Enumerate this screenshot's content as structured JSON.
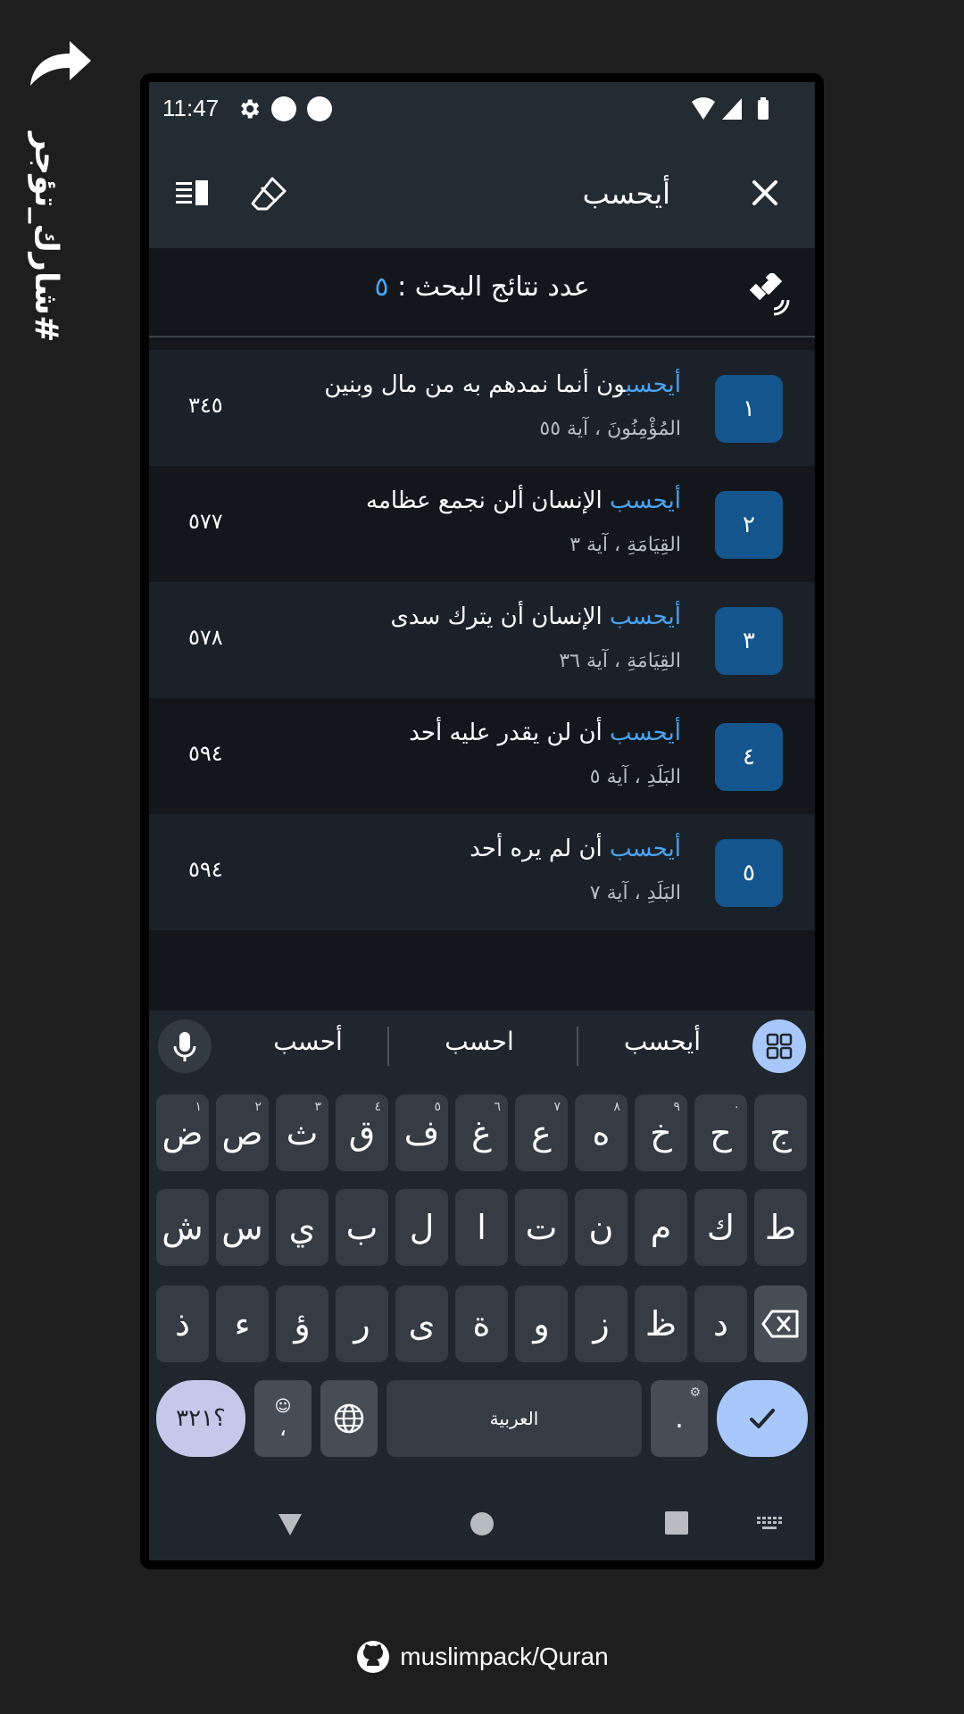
{
  "share": {
    "hashtag": "#شارك_تؤجر"
  },
  "status": {
    "time": "11:47"
  },
  "toolbar": {
    "query": "أيحسب"
  },
  "count": {
    "label": "عدد نتائج البحث :",
    "value": "٥"
  },
  "results": [
    {
      "index": "١",
      "highlight": "أيحسب",
      "rest": "ون أنما نمدهم به من مال وبنين",
      "ref": "المُؤْمِنُونَ ، آية ٥٥",
      "page": "٣٤٥"
    },
    {
      "index": "٢",
      "highlight": "أيحسب",
      "rest": " الإنسان ألن نجمع عظامه",
      "ref": "القِيَامَةِ ، آية ٣",
      "page": "٥٧٧"
    },
    {
      "index": "٣",
      "highlight": "أيحسب",
      "rest": " الإنسان أن يترك سدى",
      "ref": "القِيَامَةِ ، آية ٣٦",
      "page": "٥٧٨"
    },
    {
      "index": "٤",
      "highlight": "أيحسب",
      "rest": " أن لن يقدر عليه أحد",
      "ref": "البَلَدِ ، آية ٥",
      "page": "٥٩٤"
    },
    {
      "index": "٥",
      "highlight": "أيحسب",
      "rest": " أن لم يره أحد",
      "ref": "البَلَدِ ، آية ٧",
      "page": "٥٩٤"
    }
  ],
  "keyboard": {
    "suggestions": [
      "أيحسب",
      "احسب",
      "أحسب"
    ],
    "row1": [
      {
        "k": "ج",
        "s": ""
      },
      {
        "k": "ح",
        "s": "٠"
      },
      {
        "k": "خ",
        "s": "٩"
      },
      {
        "k": "ه",
        "s": "٨"
      },
      {
        "k": "ع",
        "s": "٧"
      },
      {
        "k": "غ",
        "s": "٦"
      },
      {
        "k": "ف",
        "s": "٥"
      },
      {
        "k": "ق",
        "s": "٤"
      },
      {
        "k": "ث",
        "s": "٣"
      },
      {
        "k": "ص",
        "s": "٢"
      },
      {
        "k": "ض",
        "s": "١"
      }
    ],
    "row2": [
      "ط",
      "ك",
      "م",
      "ن",
      "ت",
      "ا",
      "ل",
      "ب",
      "ي",
      "س",
      "ش"
    ],
    "row3": [
      "د",
      "ظ",
      "ز",
      "و",
      "ة",
      "ى",
      "ر",
      "ؤ",
      "ء",
      "ذ"
    ],
    "symbols_label": "؟٣٢١",
    "comma": "،",
    "space_label": "العربية",
    "period": "."
  },
  "footer": {
    "repo": "muslimpack/Quran"
  },
  "colors": {
    "accent": "#4aa3f0",
    "badge": "#15558e",
    "toolbar": "#232b33",
    "background": "#13171c"
  }
}
